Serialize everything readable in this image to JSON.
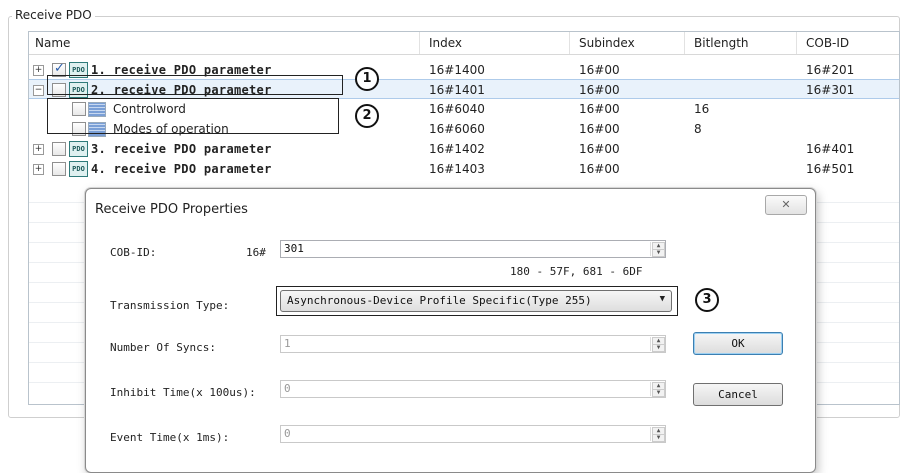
{
  "group": {
    "title": "Receive PDO"
  },
  "table": {
    "columns": [
      "Name",
      "Index",
      "Subindex",
      "Bitlength",
      "COB-ID"
    ],
    "rows": [
      {
        "name": "1. receive PDO parameter",
        "index": "16#1400",
        "subindex": "16#00",
        "bitlength": "",
        "cobid": "16#201",
        "checked": true,
        "expander": "+"
      },
      {
        "name": "2. receive PDO parameter",
        "index": "16#1401",
        "subindex": "16#00",
        "bitlength": "",
        "cobid": "16#301",
        "checked": false,
        "expander": "−"
      },
      {
        "name": "Controlword",
        "index": "16#6040",
        "subindex": "16#00",
        "bitlength": "16",
        "cobid": ""
      },
      {
        "name": "Modes of operation",
        "index": "16#6060",
        "subindex": "16#00",
        "bitlength": "8",
        "cobid": ""
      },
      {
        "name": "3. receive PDO parameter",
        "index": "16#1402",
        "subindex": "16#00",
        "bitlength": "",
        "cobid": "16#401",
        "checked": false,
        "expander": "+"
      },
      {
        "name": "4. receive PDO parameter",
        "index": "16#1403",
        "subindex": "16#00",
        "bitlength": "",
        "cobid": "16#501",
        "checked": false,
        "expander": "+"
      }
    ],
    "pdo_icon_text": "PDO"
  },
  "callouts": [
    "1",
    "2",
    "3"
  ],
  "dialog": {
    "title": "Receive PDO Properties",
    "close_label": "✕",
    "cobid_label": "COB-ID:",
    "cobid_prefix": "16#",
    "cobid_value": "301",
    "cobid_range_hint": "180 - 57F, 681 - 6DF",
    "transmission_label": "Transmission Type:",
    "transmission_value": "Asynchronous-Device Profile Specific(Type 255)",
    "syncs_label": "Number Of Syncs:",
    "syncs_value": "1",
    "inhibit_label": "Inhibit Time(x 100us):",
    "inhibit_value": "0",
    "event_label": "Event Time(x 1ms):",
    "event_value": "0",
    "ok_label": "OK",
    "cancel_label": "Cancel"
  }
}
